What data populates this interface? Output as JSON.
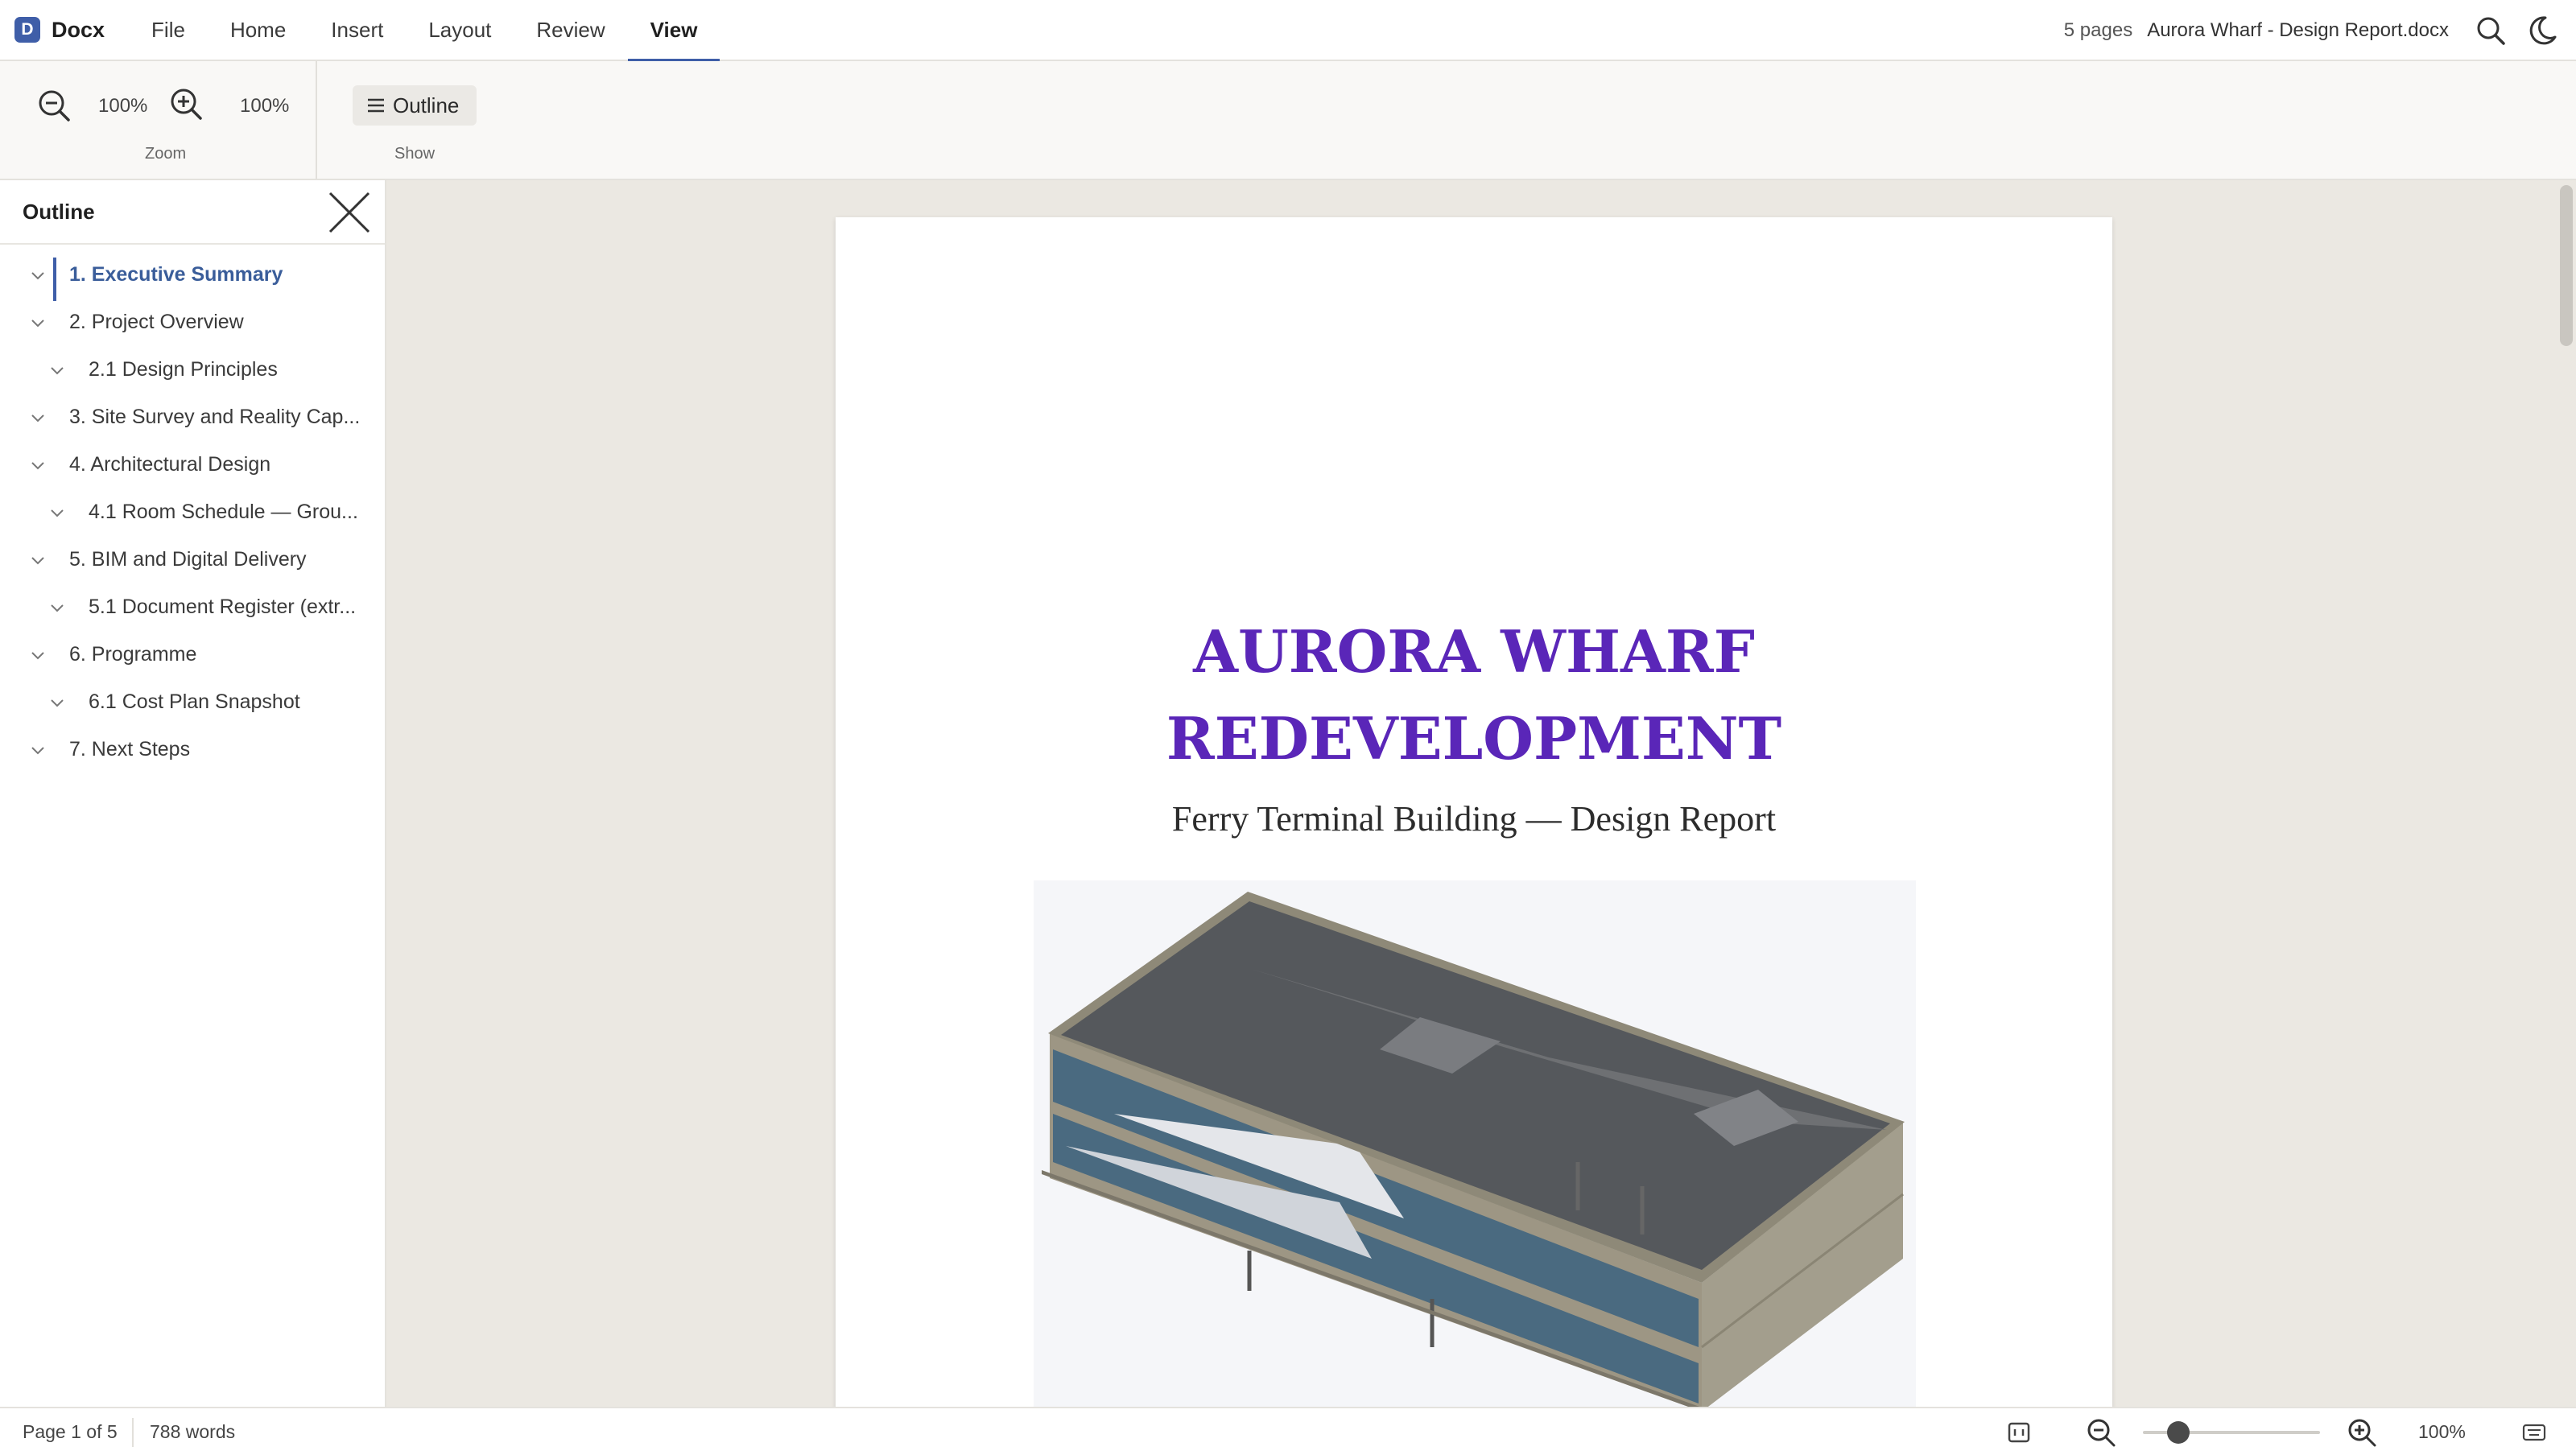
{
  "app": {
    "logo_letter": "D",
    "name": "Docx"
  },
  "menu": [
    {
      "label": "File"
    },
    {
      "label": "Home"
    },
    {
      "label": "Insert"
    },
    {
      "label": "Layout"
    },
    {
      "label": "Review"
    },
    {
      "label": "View",
      "active": true
    }
  ],
  "header": {
    "page_count": "5 pages",
    "doc_name": "Aurora Wharf - Design Report.docx",
    "icons": [
      "search-icon",
      "dark-mode-moon-icon"
    ]
  },
  "ribbon": {
    "zoom_group": {
      "zoom_out_value": "100%",
      "zoom_in_value": "100%",
      "label": "Zoom"
    },
    "show_group": {
      "outline_label": "Outline",
      "label": "Show"
    }
  },
  "sidebar": {
    "title": "Outline",
    "items": [
      {
        "label": "1. Executive Summary",
        "level": 1,
        "active": true
      },
      {
        "label": "2. Project Overview",
        "level": 1
      },
      {
        "label": "2.1 Design Principles",
        "level": 2
      },
      {
        "label": "3. Site Survey and Reality Cap...",
        "level": 1
      },
      {
        "label": "4. Architectural Design",
        "level": 1
      },
      {
        "label": "4.1 Room Schedule — Grou...",
        "level": 2
      },
      {
        "label": "5. BIM and Digital Delivery",
        "level": 1
      },
      {
        "label": "5.1 Document Register (extr...",
        "level": 2
      },
      {
        "label": "6. Programme",
        "level": 1
      },
      {
        "label": "6.1 Cost Plan Snapshot",
        "level": 2
      },
      {
        "label": "7. Next Steps",
        "level": 1
      }
    ]
  },
  "document": {
    "title_line1": "AURORA WHARF",
    "title_line2": "REDEVELOPMENT",
    "subtitle": "Ferry Terminal Building — Design Report",
    "title_color": "#5a26b8"
  },
  "status": {
    "page": "Page 1 of 5",
    "words": "788 words",
    "zoom": "100%",
    "zoom_slider_fraction": 0.2
  },
  "colors": {
    "accent": "#3f5ea8",
    "canvas": "#ebe8e2"
  }
}
